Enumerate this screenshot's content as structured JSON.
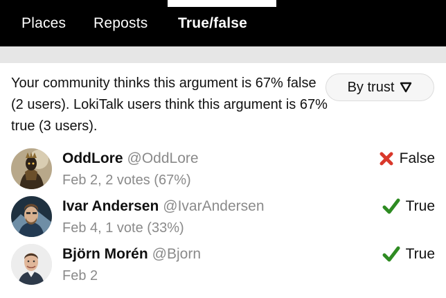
{
  "tabs": {
    "places": "Places",
    "reposts": "Reposts",
    "truefalse": "True/false"
  },
  "summary": "Your community thinks this argument is 67% false (2 users). LokiTalk users think this argument is 67% true (3 users).",
  "sort": {
    "label": "By trust"
  },
  "votes": [
    {
      "name": "OddLore",
      "handle": "@OddLore",
      "meta": "Feb 2, 2 votes (67%)",
      "verdict": "False",
      "verdict_icon": "cross-icon"
    },
    {
      "name": "Ivar Andersen",
      "handle": "@IvarAndersen",
      "meta": "Feb 4, 1 vote (33%)",
      "verdict": "True",
      "verdict_icon": "check-icon"
    },
    {
      "name": "Björn Morén",
      "handle": "@Bjorn",
      "meta": "Feb 2",
      "verdict": "True",
      "verdict_icon": "check-icon"
    }
  ],
  "colors": {
    "topbar": "#000000",
    "true": "#2e8b22",
    "false": "#d9382b",
    "muted": "#8a8a8a"
  }
}
